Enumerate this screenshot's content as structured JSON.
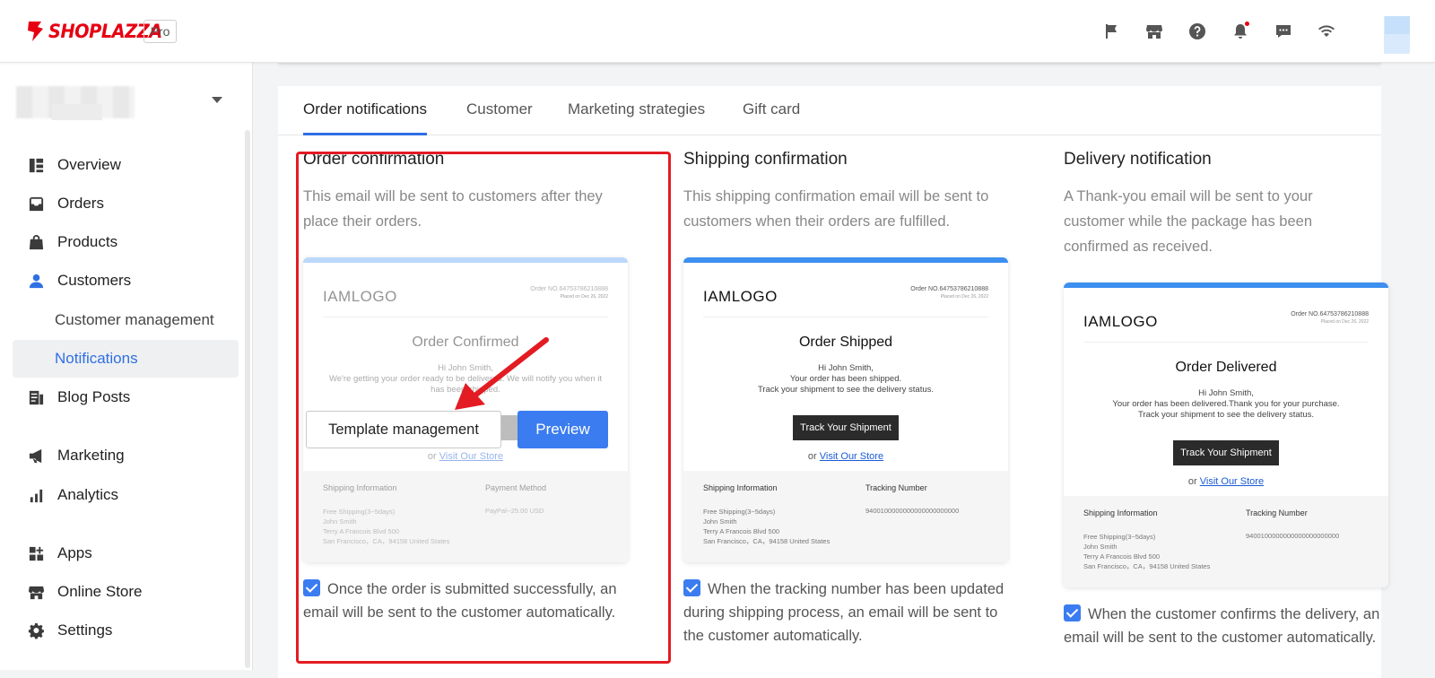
{
  "topbar": {
    "brand": "SHOPLAZZA",
    "plan": "Pro",
    "icons": [
      "flag-icon",
      "store-icon",
      "help-icon",
      "bell-icon",
      "chat-icon",
      "wifi-icon"
    ]
  },
  "sidebar": {
    "items": [
      {
        "label": "Overview",
        "icon": "overview-icon"
      },
      {
        "label": "Orders",
        "icon": "orders-icon"
      },
      {
        "label": "Products",
        "icon": "products-icon"
      },
      {
        "label": "Customers",
        "icon": "customers-icon"
      },
      {
        "label": "Customer management"
      },
      {
        "label": "Notifications"
      },
      {
        "label": "Blog Posts",
        "icon": "blog-icon"
      },
      {
        "label": "Marketing",
        "icon": "marketing-icon"
      },
      {
        "label": "Analytics",
        "icon": "analytics-icon"
      },
      {
        "label": "Apps",
        "icon": "apps-icon"
      },
      {
        "label": "Online Store",
        "icon": "online-store-icon"
      },
      {
        "label": "Settings",
        "icon": "settings-icon"
      }
    ],
    "active": "Notifications"
  },
  "tabs": [
    "Order notifications",
    "Customer",
    "Marketing strategies",
    "Gift card"
  ],
  "cards": [
    {
      "title": "Order confirmation",
      "desc": "This email will be sent to customers after they place their orders.",
      "email": {
        "logo": "IAMLOGO",
        "order_no": "Order NO.64753786210888",
        "placed": "Placed on Dec 26, 2022",
        "heading": "Order Confirmed",
        "greeting": "Hi  John Smith,",
        "body": "We're getting your order ready to be delivered. We will notify you when it has been shipped.",
        "button": "",
        "visit_prefix": "or",
        "visit_link": "Visit Our Store",
        "left_head": "Shipping Information",
        "right_head": "Payment Method",
        "left_lines": [
          "Free Shipping(3~5days)",
          "John Smith",
          "Terry A Francois Blvd 500",
          "San Francisco，CA，94158 United States"
        ],
        "right_value": "PayPal--25.00 USD"
      },
      "overlay": {
        "template_btn": "Template management",
        "preview_btn": "Preview"
      },
      "check": "Once the order is submitted successfully, an email will be sent to the customer automatically."
    },
    {
      "title": "Shipping confirmation",
      "desc": "This shipping confirmation email will be sent to customers when their orders are fulfilled.",
      "email": {
        "logo": "IAMLOGO",
        "order_no": "Order NO.64753786210888",
        "placed": "Placed on Dec 26, 2022",
        "heading": "Order Shipped",
        "greeting": "Hi  John Smith,",
        "body": "Your order has been shipped.",
        "body2": "Track your shipment to see the delivery status.",
        "button": "Track Your Shipment",
        "visit_prefix": "or",
        "visit_link": "Visit Our Store",
        "left_head": "Shipping Information",
        "right_head": "Tracking Number",
        "left_lines": [
          "Free Shipping(3~5days)",
          "John Smith",
          "Terry A Francois Blvd 500",
          "San Francisco，CA，94158 United States"
        ],
        "right_value": "9400100000000000000000000"
      },
      "check": "When the tracking number has been updated during shipping process, an email will be sent to the customer automatically."
    },
    {
      "title": "Delivery notification",
      "desc": "A Thank-you email will be sent to your customer while the package has been confirmed as received.",
      "email": {
        "logo": "IAMLOGO",
        "order_no": "Order NO.64753786210888",
        "placed": "Placed on Dec 26, 2022",
        "heading": "Order Delivered",
        "greeting": "Hi  John Smith,",
        "body": "Your order has been delivered.Thank you for your purchase.",
        "body2": "Track your shipment to see the delivery status.",
        "button": "Track Your Shipment",
        "visit_prefix": "or",
        "visit_link": "Visit Our Store",
        "left_head": "Shipping Information",
        "right_head": "Tracking Number",
        "left_lines": [
          "Free Shipping(3~5days)",
          "John Smith",
          "Terry A Francois Blvd 500",
          "San Francisco，CA，94158 United States"
        ],
        "right_value": "9400100000000000000000000"
      },
      "check": "When the customer confirms the delivery, an email will be sent to the customer automatically."
    }
  ],
  "colors": {
    "accent": "#2f6fe4",
    "brand": "#e60012",
    "highlight": "#e31b23"
  }
}
